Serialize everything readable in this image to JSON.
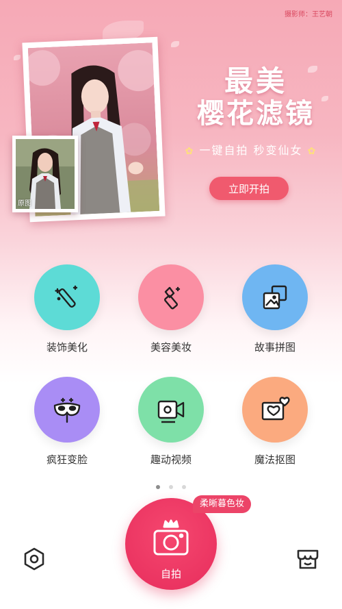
{
  "banner": {
    "credit": "摄影师：王艺朝",
    "original_label": "原图",
    "headline_line1": "最美",
    "headline_line2": "樱花滤镜",
    "tagline": "一键自拍  秒变仙女",
    "cta_label": "立即开拍"
  },
  "features": [
    {
      "label": "装饰美化",
      "icon": "magic-wand-icon",
      "color": "#5ddbd6"
    },
    {
      "label": "美容美妆",
      "icon": "lipstick-icon",
      "color": "#fb8fa3"
    },
    {
      "label": "故事拼图",
      "icon": "collage-icon",
      "color": "#6fb6f2"
    },
    {
      "label": "疯狂变脸",
      "icon": "mask-icon",
      "color": "#a98df5"
    },
    {
      "label": "趣动视频",
      "icon": "video-camera-icon",
      "color": "#7ee0a8"
    },
    {
      "label": "魔法抠图",
      "icon": "heart-photo-icon",
      "color": "#fbaa7f"
    }
  ],
  "pagination": {
    "total": 3,
    "active": 1
  },
  "bottom": {
    "camera_label": "自拍",
    "promo_badge": "柔晰暮色妆",
    "accent": "#ec4468"
  }
}
